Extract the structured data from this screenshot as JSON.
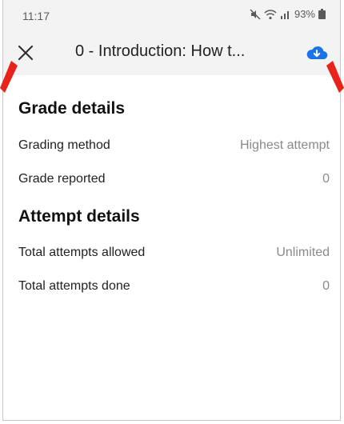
{
  "status": {
    "time": "11:17",
    "battery": "93%"
  },
  "header": {
    "title": "0 - Introduction: How t..."
  },
  "grade_details": {
    "title": "Grade details",
    "rows": [
      {
        "label": "Grading method",
        "value": "Highest attempt"
      },
      {
        "label": "Grade reported",
        "value": "0"
      }
    ]
  },
  "attempt_details": {
    "title": "Attempt details",
    "rows": [
      {
        "label": "Total attempts allowed",
        "value": "Unlimited"
      },
      {
        "label": "Total attempts done",
        "value": "0"
      }
    ]
  },
  "colors": {
    "accent": "#1a73e8",
    "annotation_arrow": "#e8231c"
  }
}
